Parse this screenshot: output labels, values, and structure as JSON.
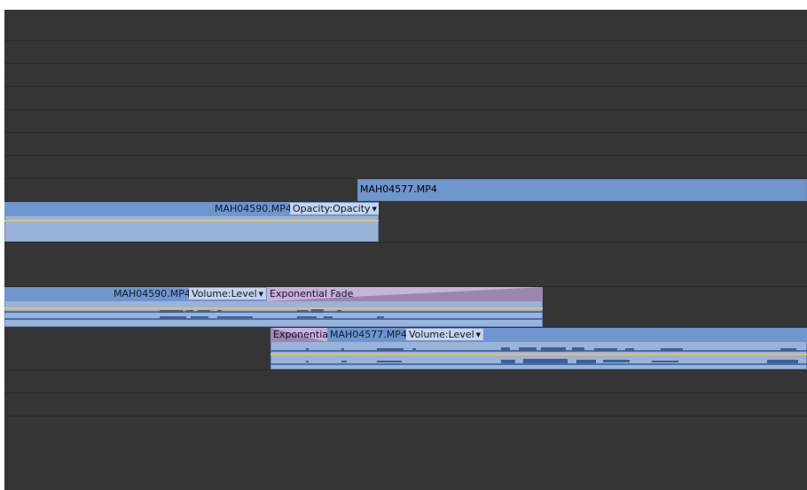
{
  "timeline": {
    "video_track_2": {
      "clip": {
        "name": "MAH04577.MP4"
      }
    },
    "video_track_1": {
      "clip": {
        "name": "MAH04590.MP4",
        "effect_menu": "Opacity:Opacity"
      }
    },
    "audio_track_1": {
      "clip": {
        "name": "MAH04590.MP4",
        "effect_menu": "Volume:Level"
      },
      "transition": {
        "label": "Exponential Fade"
      }
    },
    "audio_track_2": {
      "transition": {
        "label": "Exponential"
      },
      "clip": {
        "name": "MAH04577.MP4",
        "effect_menu": "Volume:Level"
      }
    }
  },
  "icons": {
    "dropdown": "chevron-down-icon"
  },
  "colors": {
    "panel_bg": "#353535",
    "clip_header": "#6f95cd",
    "clip_body": "#9ab3d8",
    "transition": "#c8b2d8",
    "keyframe_line": "#d6c27a"
  }
}
